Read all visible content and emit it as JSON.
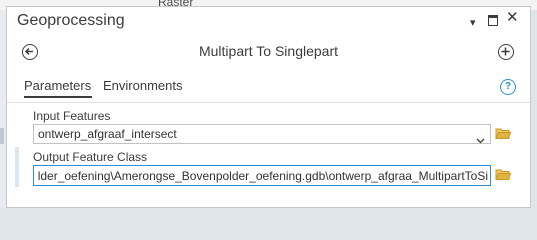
{
  "background": {
    "ribbon_label": "Raster"
  },
  "pane": {
    "title": "Geoprocessing",
    "window_controls": {
      "minimize": "▾",
      "close": "✕"
    }
  },
  "tool": {
    "name": "Multipart To Singlepart",
    "back_icon": "back-arrow-icon",
    "add_icon": "add-circle-icon"
  },
  "tabs": [
    {
      "label": "Parameters",
      "active": true
    },
    {
      "label": "Environments",
      "active": false
    }
  ],
  "help": {
    "glyph": "?"
  },
  "parameters": {
    "input_features": {
      "label": "Input Features",
      "value": "ontwerp_afgraaf_intersect"
    },
    "output_feature_class": {
      "label": "Output Feature Class",
      "value": "lder_oefening\\Amerongse_Bovenpolder_oefening.gdb\\ontwerp_afgraa_MultipartToSi"
    }
  },
  "colors": {
    "accent": "#2f8fd4",
    "folder": "#e3b341",
    "text": "#323232"
  }
}
